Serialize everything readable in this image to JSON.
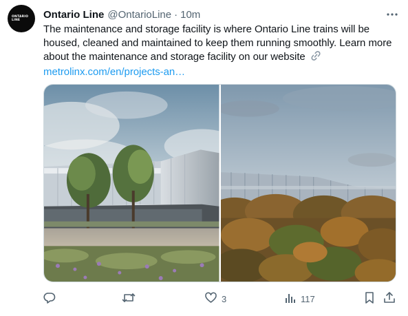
{
  "tweet": {
    "avatar_text": [
      "ONTARIO",
      "LINE"
    ],
    "display_name": "Ontario Line",
    "handle": "@OntarioLine",
    "separator": "·",
    "time": "10m",
    "text": "The maintenance and storage facility is where Ontario Line trains will be housed, cleaned and maintained to keep them running smoothly. Learn more about the maintenance and storage facility on our website",
    "link": "metrolinx.com/en/projects-an…",
    "media": [
      {
        "icon": "rendering-facility-with-trees"
      },
      {
        "icon": "rendering-facility-behind-forest"
      }
    ]
  },
  "actions": {
    "reply": {
      "icon": "reply-icon",
      "count": ""
    },
    "retweet": {
      "icon": "retweet-icon",
      "count": ""
    },
    "like": {
      "icon": "heart-icon",
      "count": "3"
    },
    "views": {
      "icon": "views-icon",
      "count": "117"
    },
    "bookmark": {
      "icon": "bookmark-icon"
    },
    "share": {
      "icon": "share-icon"
    }
  },
  "colors": {
    "text": "#0f1419",
    "secondary": "#536471",
    "link": "#1d9bf0",
    "border": "#cfd9de"
  }
}
